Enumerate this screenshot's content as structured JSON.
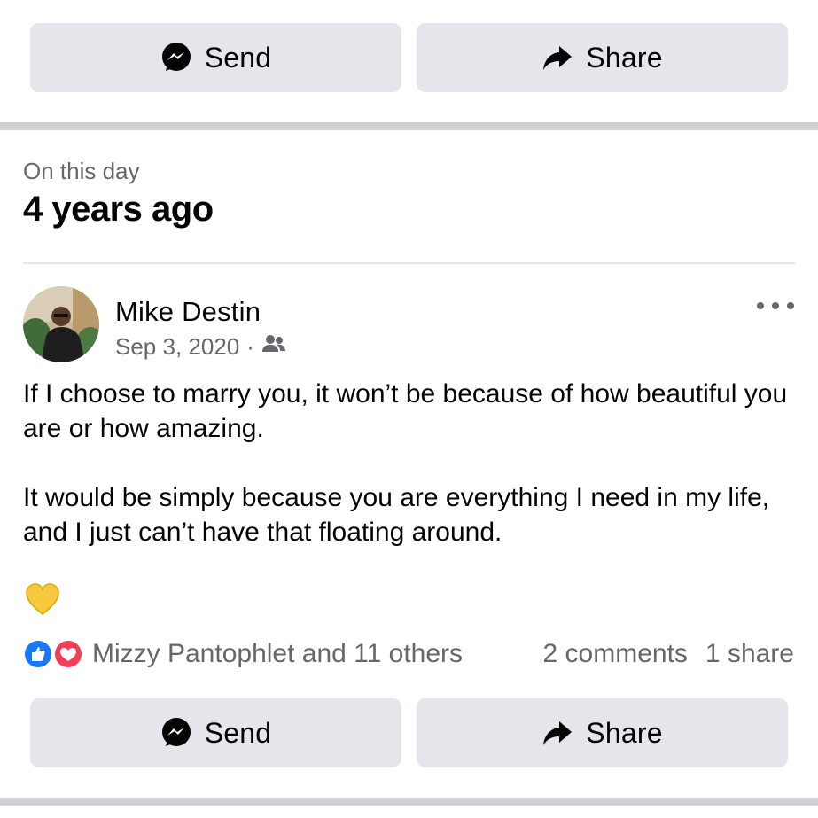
{
  "top_actions": {
    "send_label": "Send",
    "share_label": "Share"
  },
  "memory": {
    "subtitle": "On this day",
    "title": "4 years ago"
  },
  "post": {
    "author": "Mike Destin",
    "date": "Sep 3, 2020",
    "separator": "·",
    "audience_icon": "friends-icon",
    "paragraphs": [
      "If I choose to marry you, it won’t be because of how beautiful you are or how amazing.",
      "It would be simply because you are everything I need in my life, and I just can’t have that floating around."
    ],
    "emoji_icon": "yellow-heart-icon",
    "reactions": {
      "reactors_text": "Mizzy Pantophlet and 11 others",
      "comments_text": "2 comments",
      "shares_text": "1 share",
      "icons": [
        "like-icon",
        "love-icon"
      ]
    }
  },
  "bottom_actions": {
    "send_label": "Send",
    "share_label": "Share"
  },
  "colors": {
    "button_bg": "#e4e6eb",
    "secondary_text": "#65676b",
    "like_blue": "#1877f2",
    "love_red": "#f33e58",
    "heart_yellow": "#f7c93e"
  }
}
